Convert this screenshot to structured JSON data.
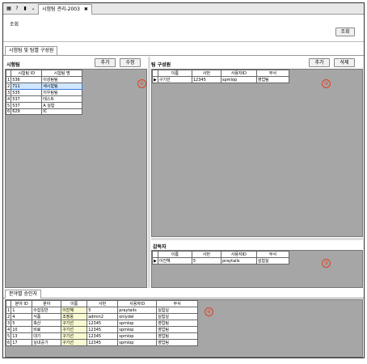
{
  "top": {
    "tab_label": "시험팀 관리-2003",
    "close": "✖"
  },
  "search": {
    "label": "조회",
    "button": "조회"
  },
  "section_tab": "시험팀 및 팀별 구성원",
  "test_team": {
    "title": "시험팀",
    "add": "추가",
    "edit": "수정",
    "columns": [
      "시험팀 ID",
      "시험팀 명"
    ],
    "rows": [
      {
        "n": "1",
        "id": "536",
        "name": "이성팀팀"
      },
      {
        "n": "2",
        "id": "711",
        "name": "새시험팀"
      },
      {
        "n": "3",
        "id": "535",
        "name": "이우팀팀"
      },
      {
        "n": "4",
        "id": "537",
        "name": "테스트"
      },
      {
        "n": "5",
        "id": "537",
        "name": "A 실험"
      },
      {
        "n": "6",
        "id": "629",
        "name": "IC"
      }
    ],
    "selected_row": 1,
    "badge": "①"
  },
  "team_members": {
    "title": "팀 구성원",
    "add": "추가",
    "delete": "삭제",
    "columns": [
      "이름",
      "사번",
      "사용자ID",
      "부서"
    ],
    "rows": [
      {
        "mark": "▶",
        "name": "구기선",
        "num": "12345",
        "uid": "spmlop",
        "dept": "영업팀"
      }
    ],
    "badge": "②"
  },
  "reviewer": {
    "title": "감독자",
    "columns": [
      "이름",
      "사번",
      "사용자ID",
      "부서"
    ],
    "rows": [
      {
        "mark": "▶",
        "name": "이진혜",
        "num": "5",
        "uid": "praytails",
        "dept": "실험실"
      }
    ],
    "badge": "③"
  },
  "bottom_tab": "분야별 승인자",
  "approvers": {
    "columns": [
      "분야 ID",
      "분야",
      "이름",
      "사번",
      "사용자ID",
      "부서"
    ],
    "rows": [
      {
        "n": "1",
        "id": "1",
        "field": "수집일반",
        "name": "이진혜",
        "num": "5",
        "uid": "praytails",
        "dept": "실험실"
      },
      {
        "n": "2",
        "id": "4",
        "field": "식품",
        "name": "조정웅",
        "num": "admin2",
        "uid": "onlydel",
        "dept": "실험실"
      },
      {
        "n": "3",
        "id": "5",
        "field": "축산",
        "name": "구기선",
        "num": "12345",
        "uid": "spmlop",
        "dept": "영업팀"
      },
      {
        "n": "4",
        "id": "10",
        "field": "비료",
        "name": "구기선",
        "num": "12345",
        "uid": "spmlop",
        "dept": "영업팀"
      },
      {
        "n": "5",
        "id": "13",
        "field": "대기",
        "name": "구기선",
        "num": "12345",
        "uid": "spmlop",
        "dept": "영업팀"
      },
      {
        "n": "6",
        "id": "17",
        "field": "실내공기",
        "name": "구기선",
        "num": "12345",
        "uid": "spmlop",
        "dept": "영업팀"
      }
    ],
    "badge": "④"
  }
}
